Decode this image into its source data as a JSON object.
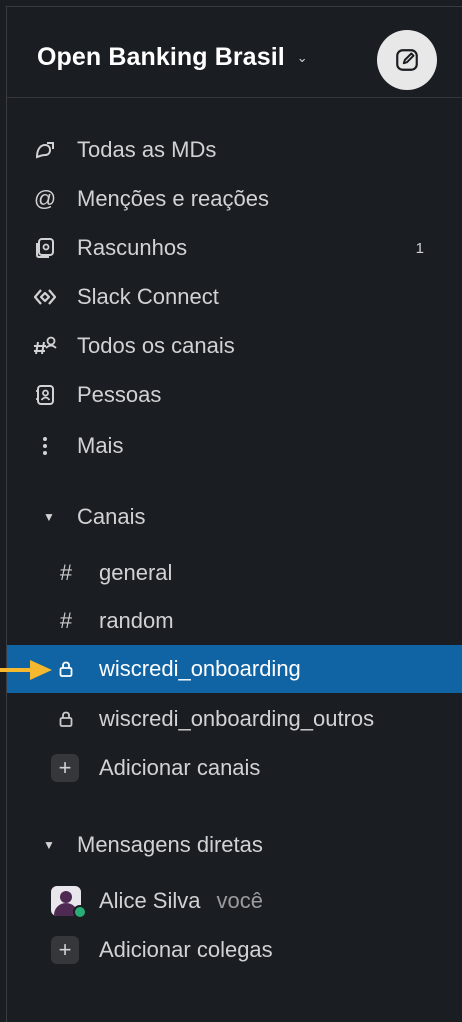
{
  "workspace": {
    "name": "Open Banking Brasil",
    "chevron": "⌄"
  },
  "nav": [
    {
      "label": "Todas as MDs",
      "icon": "dms-icon"
    },
    {
      "label": "Menções e reações",
      "icon": "at-icon"
    },
    {
      "label": "Rascunhos",
      "icon": "drafts-icon",
      "count": "1"
    },
    {
      "label": "Slack Connect",
      "icon": "slack-connect-icon"
    },
    {
      "label": "Todos os canais",
      "icon": "channel-browse-icon"
    },
    {
      "label": "Pessoas",
      "icon": "people-icon"
    },
    {
      "label": "Mais",
      "icon": "more-icon"
    }
  ],
  "channels_section": {
    "label": "Canais"
  },
  "channels": [
    {
      "label": "general",
      "type": "public"
    },
    {
      "label": "random",
      "type": "public"
    },
    {
      "label": "wiscredi_onboarding",
      "type": "private",
      "active": true
    },
    {
      "label": "wiscredi_onboarding_outros",
      "type": "private"
    }
  ],
  "add_channels": {
    "label": "Adicionar canais"
  },
  "dm_section": {
    "label": "Mensagens diretas"
  },
  "dms": [
    {
      "name": "Alice Silva",
      "suffix": "você"
    }
  ],
  "add_colleagues": {
    "label": "Adicionar colegas"
  },
  "colors": {
    "active_bg": "#1164a3",
    "pointer_arrow": "#f5b82e",
    "presence": "#2bac76"
  }
}
